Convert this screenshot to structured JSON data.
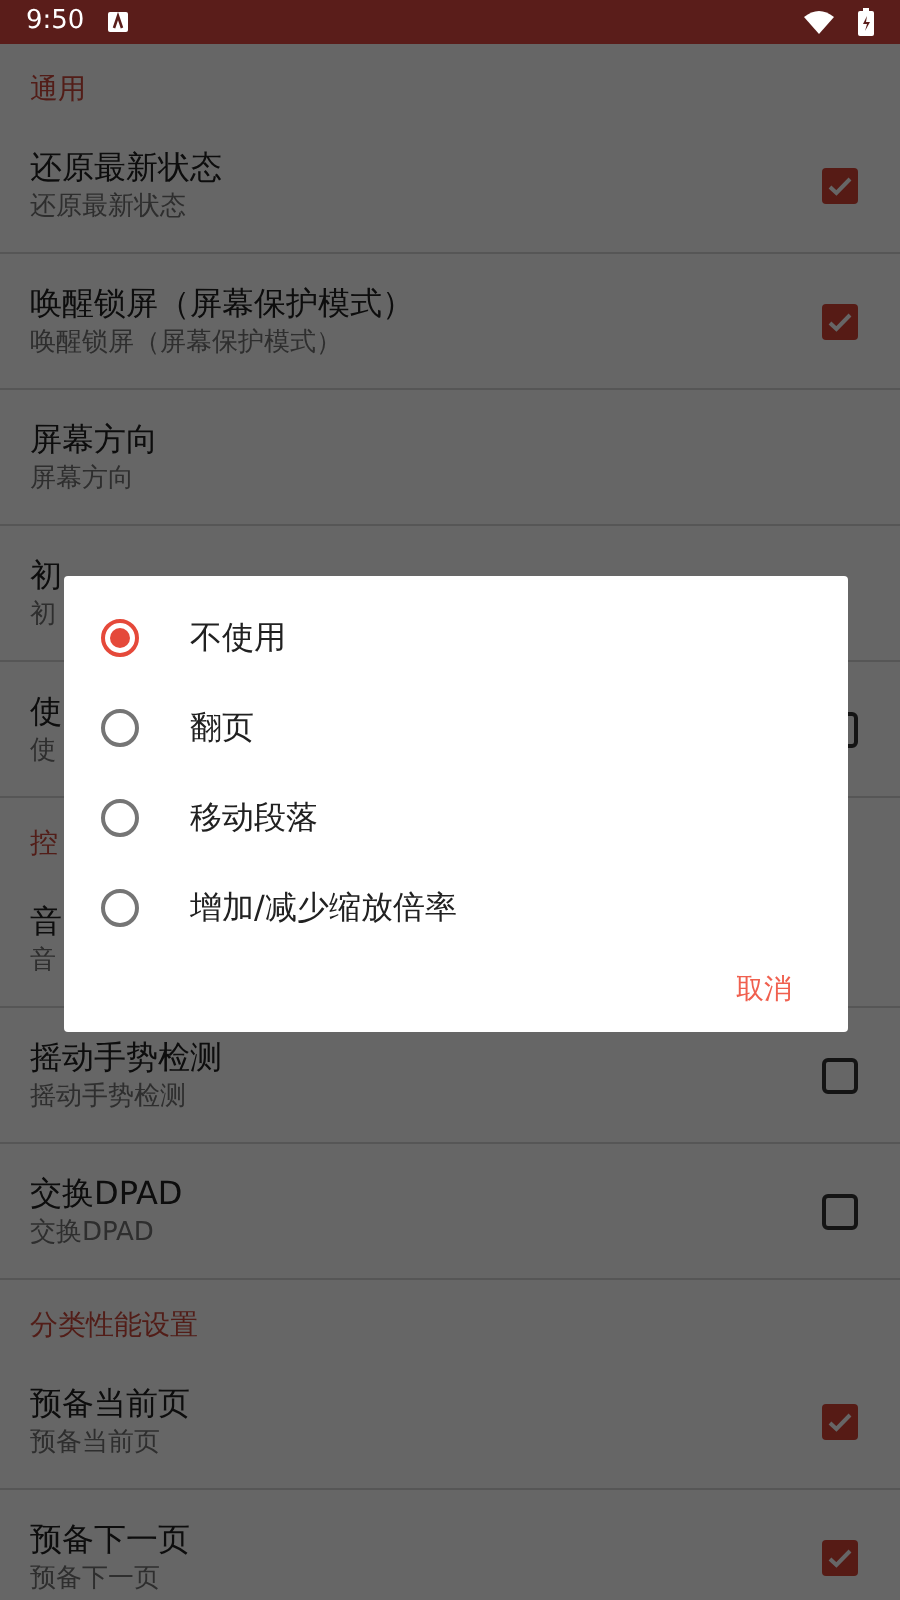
{
  "status_bar": {
    "time": "9:50"
  },
  "settings": [
    {
      "kind": "header",
      "title": "通用"
    },
    {
      "kind": "checkbox_row",
      "title": "还原最新状态",
      "subtitle": "还原最新状态",
      "checked": true
    },
    {
      "kind": "checkbox_row",
      "title": "唤醒锁屏（屏幕保护模式）",
      "subtitle": "唤醒锁屏（屏幕保护模式）",
      "checked": true
    },
    {
      "kind": "text_row",
      "title": "屏幕方向",
      "subtitle": "屏幕方向"
    },
    {
      "kind": "text_row",
      "title": "初",
      "subtitle": "初"
    },
    {
      "kind": "checkbox_row",
      "title": "使",
      "subtitle": "使",
      "checked": false
    },
    {
      "kind": "header",
      "title": "控"
    },
    {
      "kind": "text_row",
      "title": "音",
      "subtitle": "音"
    },
    {
      "kind": "checkbox_row",
      "title": "摇动手势检测",
      "subtitle": "摇动手势检测",
      "checked": false
    },
    {
      "kind": "checkbox_row",
      "title": "交换DPAD",
      "subtitle": "交换DPAD",
      "checked": false
    },
    {
      "kind": "header",
      "title": "分类性能设置"
    },
    {
      "kind": "checkbox_row",
      "title": "预备当前页",
      "subtitle": "预备当前页",
      "checked": true
    },
    {
      "kind": "checkbox_row",
      "title": "预备下一页",
      "subtitle": "预备下一页",
      "checked": true
    }
  ],
  "dialog": {
    "options": [
      {
        "label": "不使用",
        "selected": true
      },
      {
        "label": "翻页",
        "selected": false
      },
      {
        "label": "移动段落",
        "selected": false
      },
      {
        "label": "增加/减少缩放倍率",
        "selected": false
      }
    ],
    "cancel": "取消"
  }
}
